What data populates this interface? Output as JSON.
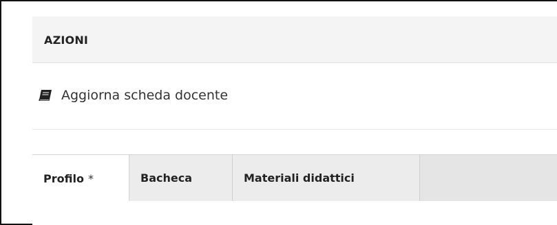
{
  "panel": {
    "title": "AZIONI"
  },
  "actions": [
    {
      "label": "Aggiorna scheda docente",
      "icon": "book-icon"
    }
  ],
  "tabs": [
    {
      "label": "Profilo",
      "marker": "*",
      "active": true
    },
    {
      "label": "Bacheca",
      "active": false
    },
    {
      "label": "Materiali didattici",
      "active": false
    }
  ],
  "colors": {
    "header_bg": "#f4f4f4",
    "tabbar_bg": "#e5e5e5",
    "active_tab_bg": "#ffffff",
    "text": "#333333"
  }
}
